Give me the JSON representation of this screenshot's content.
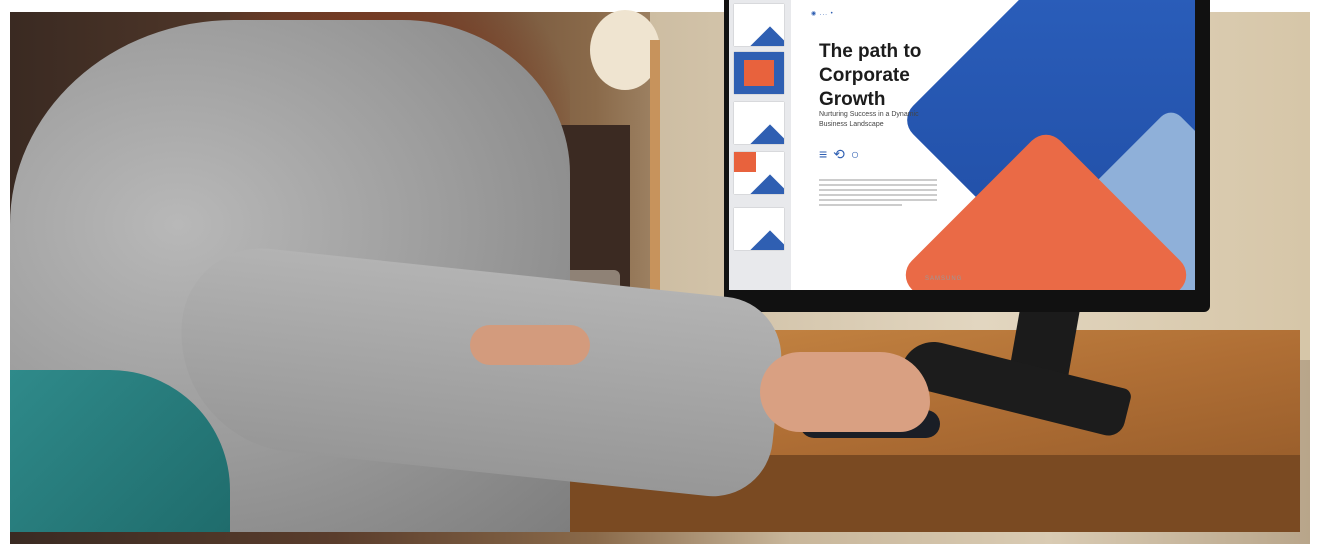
{
  "image": {
    "type": "photo",
    "subject": "person-at-desk-with-curved-monitor",
    "colors": {
      "accent_blue": "#2f5fb2",
      "accent_orange": "#ea6a46",
      "desk": "#b06f35",
      "sweater": "#a0a0a0",
      "chair": "#2f8a8a"
    }
  },
  "monitor": {
    "brand": "SAMSUNG",
    "slide": {
      "logo": "◉ ... •",
      "title": "The path to Corporate Growth",
      "subtitle": "Nurturing Success in a Dynamic Business Landscape",
      "icons": [
        "chart-icon",
        "growth-icon",
        "idea-icon"
      ]
    },
    "thumbnail_count": 5
  }
}
